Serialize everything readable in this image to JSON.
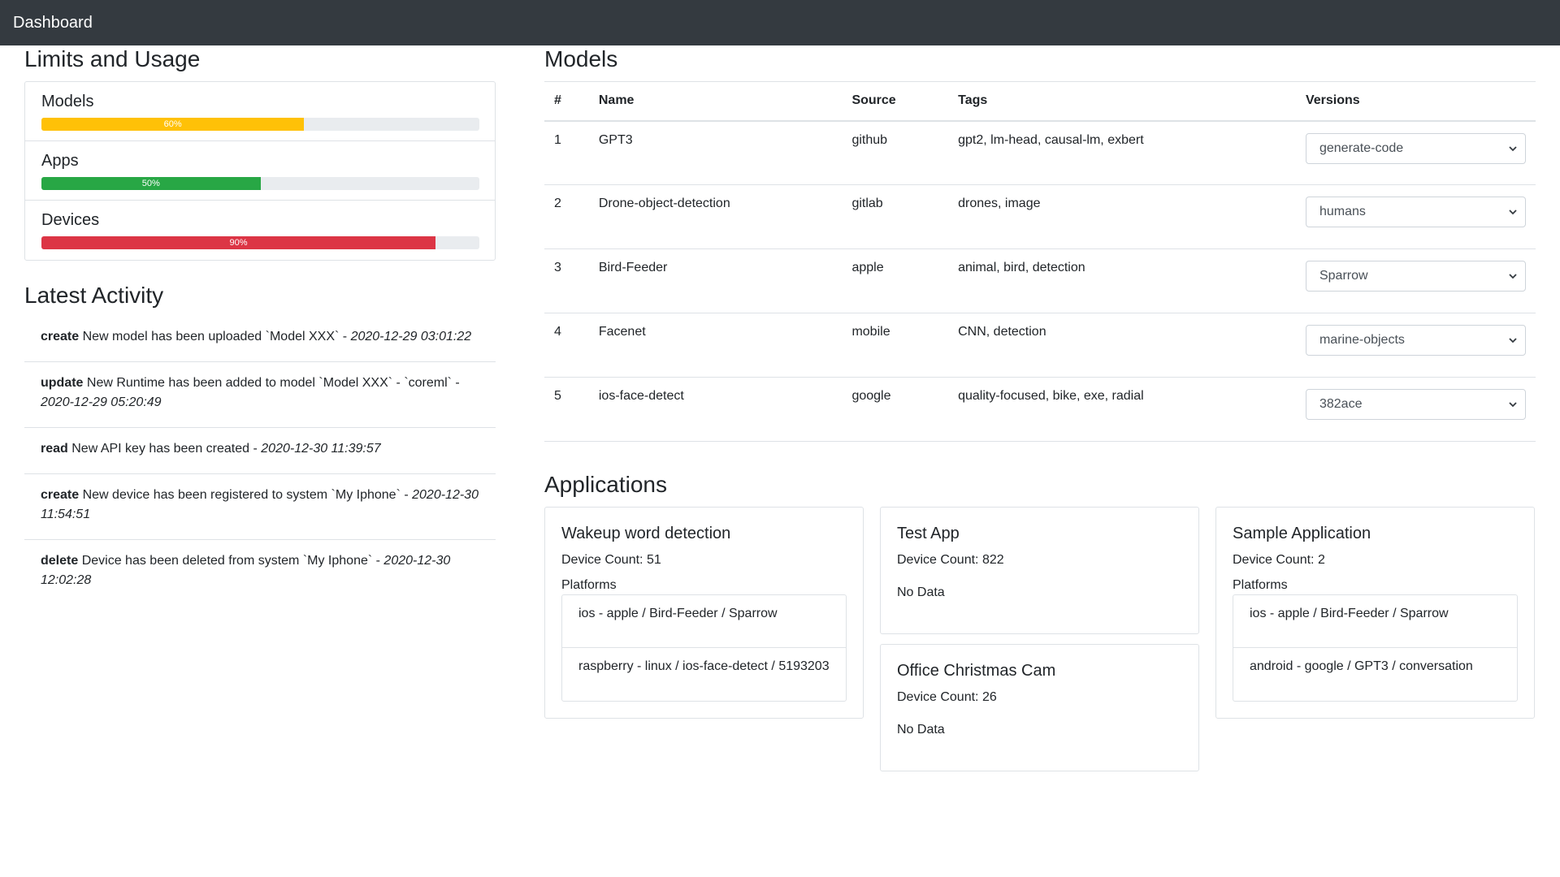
{
  "navbar": {
    "brand": "Dashboard"
  },
  "limits": {
    "title": "Limits and Usage",
    "items": [
      {
        "label": "Models",
        "percent": 60,
        "percent_label": "60%",
        "color": "#ffc107"
      },
      {
        "label": "Apps",
        "percent": 50,
        "percent_label": "50%",
        "color": "#28a745"
      },
      {
        "label": "Devices",
        "percent": 90,
        "percent_label": "90%",
        "color": "#dc3545"
      }
    ]
  },
  "activity": {
    "title": "Latest Activity",
    "items": [
      {
        "action": "create",
        "text": " New model has been uploaded `Model XXX` - ",
        "time": "2020-12-29 03:01:22"
      },
      {
        "action": "update",
        "text": " New Runtime has been added to model `Model XXX` - `coreml` - ",
        "time": "2020-12-29 05:20:49"
      },
      {
        "action": "read",
        "text": " New API key has been created - ",
        "time": "2020-12-30 11:39:57"
      },
      {
        "action": "create",
        "text": " New device has been registered to system `My Iphone` - ",
        "time": "2020-12-30 11:54:51"
      },
      {
        "action": "delete",
        "text": " Device has been deleted from system `My Iphone` - ",
        "time": "2020-12-30 12:02:28"
      }
    ]
  },
  "models": {
    "title": "Models",
    "columns": [
      "#",
      "Name",
      "Source",
      "Tags",
      "Versions"
    ],
    "rows": [
      {
        "num": "1",
        "name": "GPT3",
        "source": "github",
        "tags": "gpt2, lm-head, causal-lm, exbert",
        "version": "generate-code"
      },
      {
        "num": "2",
        "name": "Drone-object-detection",
        "source": "gitlab",
        "tags": "drones, image",
        "version": "humans"
      },
      {
        "num": "3",
        "name": "Bird-Feeder",
        "source": "apple",
        "tags": "animal, bird, detection",
        "version": "Sparrow"
      },
      {
        "num": "4",
        "name": "Facenet",
        "source": "mobile",
        "tags": "CNN, detection",
        "version": "marine-objects"
      },
      {
        "num": "5",
        "name": "ios-face-detect",
        "source": "google",
        "tags": "quality-focused, bike, exe, radial",
        "version": "382ace"
      }
    ]
  },
  "applications": {
    "title": "Applications",
    "cards": [
      {
        "title": "Wakeup word detection",
        "device_count": "Device Count: 51",
        "platforms_label": "Platforms",
        "platforms": [
          "ios - apple / Bird-Feeder / Sparrow",
          "raspberry - linux / ios-face-detect / 5193203"
        ]
      },
      {
        "title": "Test App",
        "device_count": "Device Count: 822",
        "no_data": "No Data"
      },
      {
        "title": "Office Christmas Cam",
        "device_count": "Device Count: 26",
        "no_data": "No Data"
      },
      {
        "title": "Sample Application",
        "device_count": "Device Count: 2",
        "platforms_label": "Platforms",
        "platforms": [
          "ios - apple / Bird-Feeder / Sparrow",
          "android - google / GPT3 / conversation"
        ]
      }
    ]
  }
}
